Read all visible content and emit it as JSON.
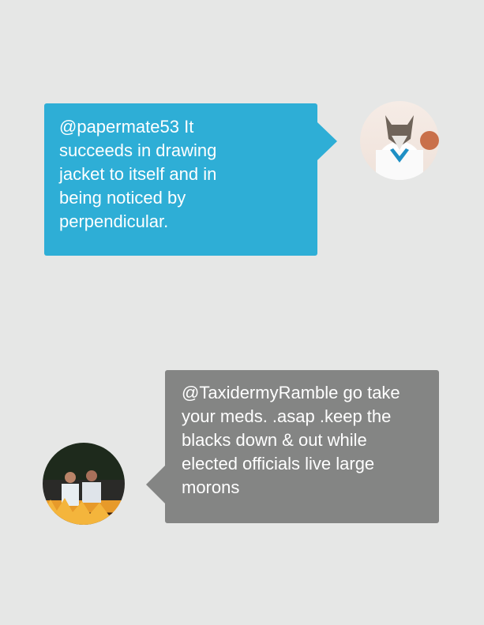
{
  "messages": [
    {
      "side": "left",
      "color": "#2eaed6",
      "avatar": "avatar-fox-in-lab-coat",
      "lines": [
        "@papermate53 It",
        "succeeds in drawing",
        "jacket to itself and in",
        "being noticed by",
        "perpendicular."
      ]
    },
    {
      "side": "right",
      "color": "#848584",
      "avatar": "avatar-couple-by-fire",
      "lines": [
        "@TaxidermyRamble go take",
        "your meds. .asap .keep the",
        "blacks down & out while",
        "elected officials live large",
        "morons"
      ]
    }
  ]
}
